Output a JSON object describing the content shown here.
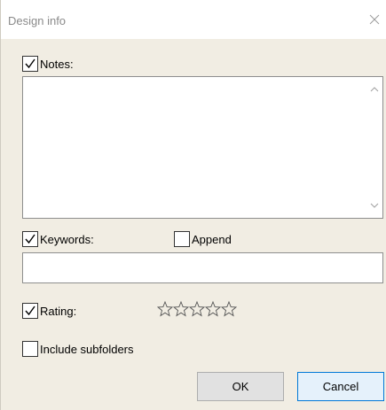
{
  "dialog": {
    "title": "Design info",
    "close_icon": "close-icon"
  },
  "notes": {
    "label": "Notes:",
    "checked": true,
    "value": ""
  },
  "keywords": {
    "label": "Keywords:",
    "checked": true,
    "value": "",
    "append_label": "Append",
    "append_checked": false
  },
  "rating": {
    "label": "Rating:",
    "checked": true,
    "value": 0,
    "max": 5
  },
  "include_subfolders": {
    "label": "Include subfolders",
    "checked": false
  },
  "buttons": {
    "ok": "OK",
    "cancel": "Cancel"
  },
  "colors": {
    "background": "#f1ede3",
    "accent": "#0078d7"
  }
}
